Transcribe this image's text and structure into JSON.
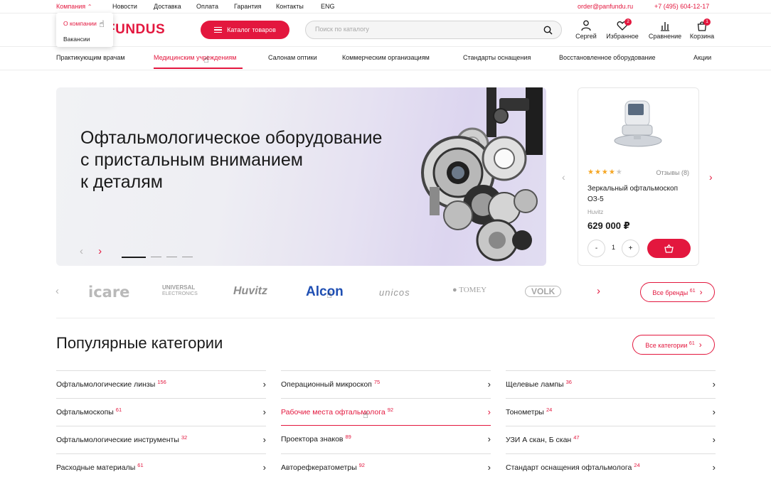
{
  "topbar": {
    "company": "Компания",
    "links": [
      "Новости",
      "Доставка",
      "Оплата",
      "Гарантия",
      "Контакты",
      "ENG"
    ],
    "email": "order@panfundu.ru",
    "phone": "+7 (495) 604-12-17"
  },
  "dropdown": {
    "items": [
      "О компании",
      "Вакансии"
    ]
  },
  "header": {
    "logo_text": "FUNDUS",
    "catalog_label": "Каталог товаров",
    "search_placeholder": "Поиск по каталогу",
    "user_label": "Сергей",
    "favorites_label": "Избранное",
    "favorites_count": "2",
    "compare_label": "Сравнение",
    "cart_label": "Корзина",
    "cart_count": "1"
  },
  "nav": {
    "items": [
      "Практикующим врачам",
      "Медицинским учреждениям",
      "Салонам оптики",
      "Коммерческим организациям",
      "Стандарты оснащения",
      "Восстановленное оборудование",
      "Акции"
    ]
  },
  "hero": {
    "title_lines": [
      "Офтальмологическое оборудование",
      "с пристальным вниманием",
      "к деталям"
    ]
  },
  "product": {
    "rating": 4.5,
    "reviews": "Отзывы (8)",
    "name": "Зеркальный офтальмоскоп ОЗ-5",
    "brand": "Huvitz",
    "price": "629 000 ₽",
    "quantity": "1"
  },
  "brands": {
    "logos": [
      "icare",
      "UNIVERSAL",
      "Huvitz",
      "Alcon",
      "unicos",
      "TOMEY",
      "VOLK"
    ],
    "universal_sub": "ELECTRONICS",
    "all_label": "Все бренды",
    "all_count": "61"
  },
  "categories": {
    "title": "Популярные категории",
    "all_label": "Все категории",
    "all_count": "61",
    "columns": [
      [
        {
          "label": "Офтальмологические линзы",
          "count": "156"
        },
        {
          "label": "Офтальмоскопы",
          "count": "61"
        },
        {
          "label": "Офтальмологические инструменты",
          "count": "32"
        },
        {
          "label": "Расходные материалы",
          "count": "61"
        }
      ],
      [
        {
          "label": "Операционный микроскоп",
          "count": "75"
        },
        {
          "label": "Рабочие места офтальмолога",
          "count": "92"
        },
        {
          "label": "Проектора знаков",
          "count": "89"
        },
        {
          "label": "Авторефкератометры",
          "count": "92"
        }
      ],
      [
        {
          "label": "Щелевые лампы",
          "count": "36"
        },
        {
          "label": "Тонометры",
          "count": "24"
        },
        {
          "label": "УЗИ А скан, Б скан",
          "count": "47"
        },
        {
          "label": "Стандарт оснащения офтальмолога",
          "count": "24"
        }
      ]
    ]
  },
  "colors": {
    "accent": "#e3173e"
  }
}
